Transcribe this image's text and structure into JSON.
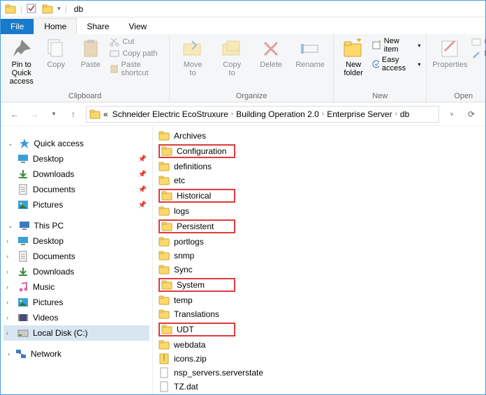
{
  "window": {
    "title": "db"
  },
  "tabs": {
    "file": "File",
    "home": "Home",
    "share": "Share",
    "view": "View"
  },
  "ribbon": {
    "clipboard": {
      "label": "Clipboard",
      "pin": "Pin to Quick\naccess",
      "copy": "Copy",
      "paste": "Paste",
      "cut": "Cut",
      "copypath": "Copy path",
      "pasteshortcut": "Paste shortcut"
    },
    "organize": {
      "label": "Organize",
      "moveto": "Move\nto",
      "copyto": "Copy\nto",
      "delete": "Delete",
      "rename": "Rename"
    },
    "new": {
      "label": "New",
      "newfolder": "New\nfolder",
      "newitem": "New item",
      "easyaccess": "Easy access"
    },
    "open": {
      "label": "Open",
      "properties": "Properties",
      "open": "Op",
      "edit": "Ed"
    }
  },
  "breadcrumb": {
    "items": [
      "Schneider Electric EcoStruxure",
      "Building Operation 2.0",
      "Enterprise Server",
      "db"
    ],
    "leading": "«"
  },
  "sidebar": {
    "quick": {
      "label": "Quick access"
    },
    "pinned": [
      {
        "label": "Desktop"
      },
      {
        "label": "Downloads"
      },
      {
        "label": "Documents"
      },
      {
        "label": "Pictures"
      }
    ],
    "thispc": {
      "label": "This PC"
    },
    "drives": [
      {
        "label": "Desktop",
        "icon": "desktop"
      },
      {
        "label": "Documents",
        "icon": "doc"
      },
      {
        "label": "Downloads",
        "icon": "download"
      },
      {
        "label": "Music",
        "icon": "music"
      },
      {
        "label": "Pictures",
        "icon": "picture"
      },
      {
        "label": "Videos",
        "icon": "video"
      },
      {
        "label": "Local Disk (C:)",
        "icon": "disk",
        "selected": true
      }
    ],
    "network": {
      "label": "Network"
    }
  },
  "files": [
    {
      "name": "Archives",
      "type": "folder",
      "hl": false
    },
    {
      "name": "Configuration",
      "type": "folder",
      "hl": true
    },
    {
      "name": "definitions",
      "type": "folder",
      "hl": false
    },
    {
      "name": "etc",
      "type": "folder",
      "hl": false
    },
    {
      "name": "Historical",
      "type": "folder",
      "hl": true
    },
    {
      "name": "logs",
      "type": "folder",
      "hl": false
    },
    {
      "name": "Persistent",
      "type": "folder",
      "hl": true
    },
    {
      "name": "portlogs",
      "type": "folder",
      "hl": false
    },
    {
      "name": "snmp",
      "type": "folder",
      "hl": false
    },
    {
      "name": "Sync",
      "type": "folder",
      "hl": false
    },
    {
      "name": "System",
      "type": "folder",
      "hl": true
    },
    {
      "name": "temp",
      "type": "folder",
      "hl": false
    },
    {
      "name": "Translations",
      "type": "folder",
      "hl": false
    },
    {
      "name": "UDT",
      "type": "folder",
      "hl": true
    },
    {
      "name": "webdata",
      "type": "folder",
      "hl": false
    },
    {
      "name": "icons.zip",
      "type": "zip",
      "hl": false
    },
    {
      "name": "nsp_servers.serverstate",
      "type": "file",
      "hl": false
    },
    {
      "name": "TZ.dat",
      "type": "file",
      "hl": false
    }
  ]
}
